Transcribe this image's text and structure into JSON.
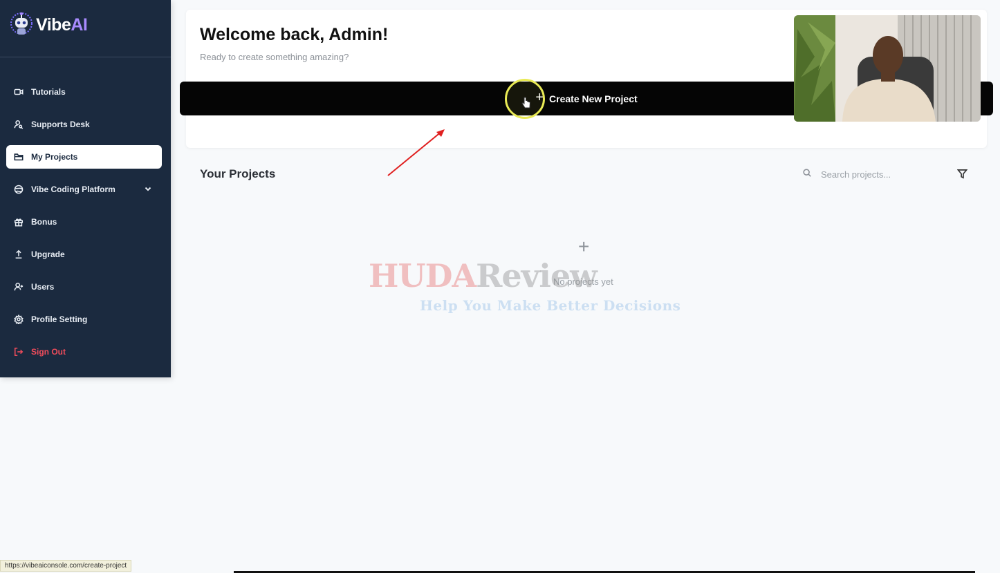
{
  "brand": {
    "name_main": "Vibe",
    "name_accent": "AI"
  },
  "sidebar": {
    "items": [
      {
        "label": "Tutorials",
        "icon": "video-icon"
      },
      {
        "label": "Supports Desk",
        "icon": "user-search-icon"
      },
      {
        "label": "My Projects",
        "icon": "folder-icon",
        "active": true
      },
      {
        "label": "Vibe Coding Platform",
        "icon": "globe-icon",
        "has_submenu": true
      },
      {
        "label": "Bonus",
        "icon": "gift-icon"
      },
      {
        "label": "Upgrade",
        "icon": "upload-icon"
      },
      {
        "label": "Users",
        "icon": "user-plus-icon"
      },
      {
        "label": "Profile Setting",
        "icon": "gear-icon"
      },
      {
        "label": "Sign Out",
        "icon": "logout-icon"
      }
    ]
  },
  "welcome": {
    "title": "Welcome back, Admin!",
    "subtitle": "Ready to create something amazing?",
    "create_label": "Create New Project",
    "create_icon": "plus-icon"
  },
  "projects": {
    "title": "Your Projects",
    "search_placeholder": "Search projects...",
    "empty_text": "No projects yet"
  },
  "watermark": {
    "brand_part1": "HUDA",
    "brand_part2": "Review",
    "tagline": "Help You Make Better Decisions"
  },
  "status_bar": {
    "url": "https://vibeaiconsole.com/create-project"
  },
  "colors": {
    "sidebar_bg": "#1b2a3f",
    "accent": "#a88bff",
    "signout": "#ef4c5b",
    "cta_bg": "#050505"
  }
}
